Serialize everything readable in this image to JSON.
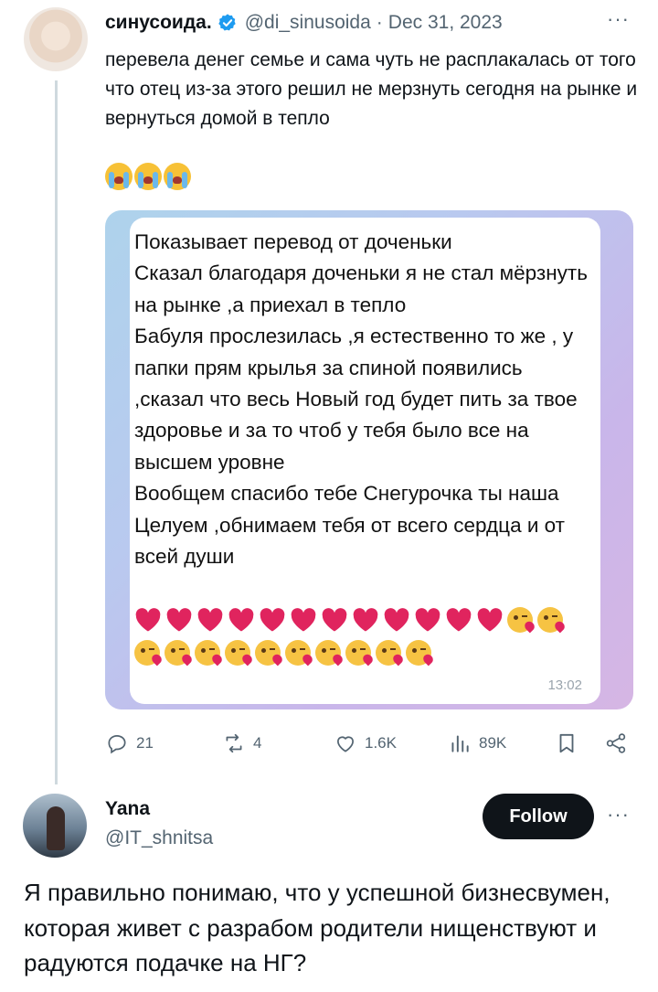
{
  "tweet": {
    "author_name": "синусоида.",
    "handle": "@di_sinusoida",
    "separator": "·",
    "date": "Dec 31, 2023",
    "more": "···",
    "text": "перевела денег семье и сама чуть не расплакалась от того что отец из-за этого решил не мерзнуть сегодня на рынке и вернуться домой в тепло",
    "emoji": [
      "loudly-crying-face",
      "loudly-crying-face",
      "loudly-crying-face"
    ],
    "media": {
      "message_text": "Показывает перевод от доченьки\nСказал благодаря доченьки я не стал мёрзнуть на рынке ,а приехал в тепло\nБабуля прослезилась ,я естественно то же , у папки прям крылья за спиной появились ,сказал что весь Новый год будет пить за твое здоровье и за то чтоб у тебя было все на высшем уровне\nВообщем спасибо тебе Снегурочка ты наша\nЦелуем ,обнимаем тебя от всего сердца и от всей души",
      "hearts": 12,
      "kisses": 12,
      "time": "13:02"
    },
    "stats": {
      "replies": "21",
      "reposts": "4",
      "likes": "1.6K",
      "views": "89K"
    }
  },
  "reply": {
    "author_name": "Yana",
    "handle": "@IT_shnitsa",
    "follow_label": "Follow",
    "more": "···",
    "text": "Я правильно понимаю, что у успешной бизнесвумен, которая живет с разрабом родители нищенствуют и радуются подачке на НГ?"
  },
  "colors": {
    "text": "#0f1419",
    "secondary": "#536471",
    "verified": "#1d9bf0",
    "heart": "#e0245e"
  }
}
